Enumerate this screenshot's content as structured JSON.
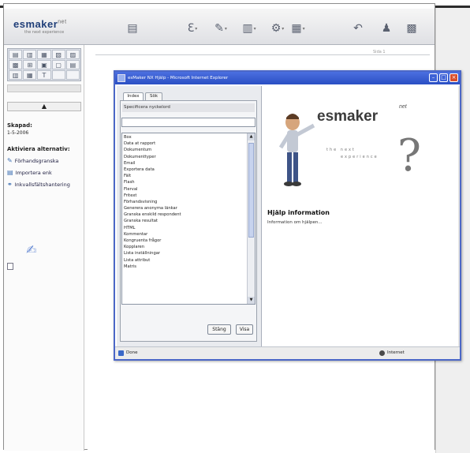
{
  "app": {
    "logo": "esmaker",
    "logo_sup": "net",
    "tagline": "the next experience"
  },
  "toolbar": [
    {
      "icon": "picture-icon",
      "glyph": "▤"
    },
    {
      "icon": "text-tool-icon",
      "glyph": "Ɛ"
    },
    {
      "icon": "format-icon",
      "glyph": "✎"
    },
    {
      "icon": "document-icon",
      "glyph": "▥"
    },
    {
      "icon": "tool-icon",
      "glyph": "⚙"
    },
    {
      "icon": "export-icon",
      "glyph": "▦"
    },
    {
      "icon": "undo-icon",
      "glyph": "↶"
    },
    {
      "icon": "user-icon",
      "glyph": "♟"
    },
    {
      "icon": "report-icon",
      "glyph": "▩"
    }
  ],
  "sidebar": {
    "arrow": "▲",
    "skapad_label": "Skapad:",
    "skapad_value": "1-5-2006",
    "alternatives_label": "Aktiviera alternativ:",
    "items": [
      {
        "icon": "pencil-icon",
        "glyph": "✎",
        "label": "Förhandsgranska"
      },
      {
        "icon": "import-icon",
        "glyph": "▤",
        "label": "Importera enk"
      },
      {
        "icon": "link-icon",
        "glyph": "⚭",
        "label": "Inkvallsfältshantering"
      }
    ]
  },
  "workspace": {
    "ruler_label": "Sida 1"
  },
  "dialog": {
    "title": "esMaker NX Hjälp - Microsoft Internet Explorer",
    "tabs": [
      "Index",
      "Sök"
    ],
    "search_label": "Specificera nyckelord",
    "search_value": "",
    "list_items": [
      "Box",
      "Data at rapport",
      "Dokumentum",
      "Dokumenttyper",
      "Email",
      "Exportera data",
      "Fält",
      "Flash",
      "Flerval",
      "Fritext",
      "Förhandsvisning",
      "Generera anonyma länkar",
      "Granska enskild respondent",
      "Granska resultat",
      "HTML",
      "Kommentar",
      "Kongruenta frågor",
      "Kopplaren",
      "Lista inställningar",
      "Lista attribut",
      "Matris"
    ],
    "btn_visa": "Visa",
    "btn_stang": "Stäng",
    "right": {
      "logo_es": "es",
      "logo_maker": "maker",
      "logo_sup": "net",
      "experience_1": "the next",
      "experience_2": "experience",
      "help_title": "Hjälp information",
      "help_sub": "Information om hjälpen..."
    },
    "status_left": "Done",
    "status_right": "Internet"
  }
}
